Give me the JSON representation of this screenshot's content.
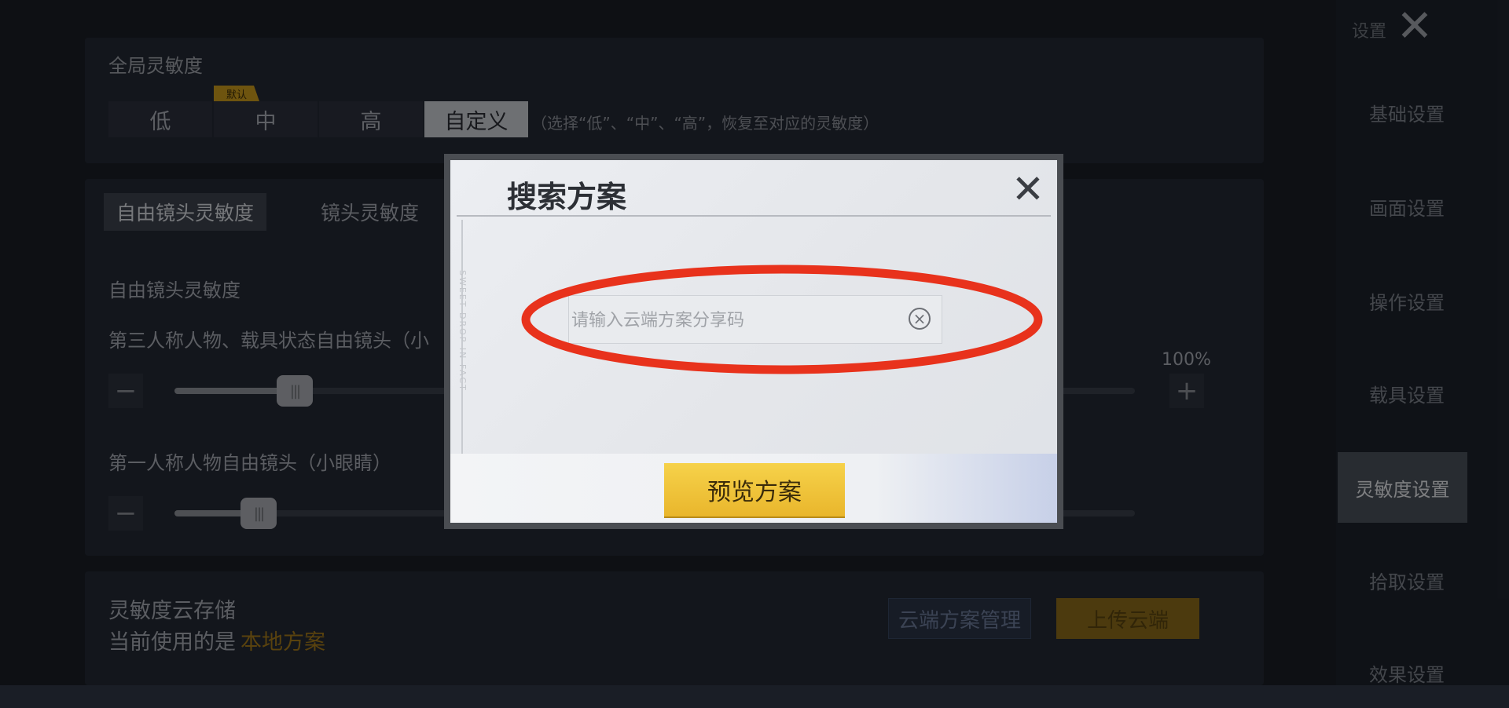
{
  "header": {
    "settings_label": "设置",
    "close_label": "✕"
  },
  "global": {
    "title": "全局灵敏度",
    "default_tag": "默认",
    "presets": [
      "低",
      "中",
      "高",
      "自定义"
    ],
    "hint": "（选择“低”、“中”、“高”，恢复至对应的灵敏度）"
  },
  "tabs": [
    "自由镜头灵敏度",
    "镜头灵敏度"
  ],
  "section": {
    "title": "自由镜头灵敏度",
    "row1_label": "第三人称人物、载具状态自由镜头（小",
    "row1_value": 0.21,
    "row1_percent": "100%",
    "row2_label": "第一人称人物自由镜头（小眼睛）",
    "row2_value": 0.15,
    "minus": "−",
    "plus": "+"
  },
  "cloud": {
    "title": "灵敏度云存储",
    "current_prefix": "当前使用的是",
    "current_value": "本地方案",
    "manage_button": "云端方案管理",
    "upload_button": "上传云端"
  },
  "sidebar": {
    "items": [
      "基础设置",
      "画面设置",
      "操作设置",
      "载具设置",
      "灵敏度设置",
      "拾取设置",
      "效果设置"
    ],
    "active_index": 4
  },
  "dialog": {
    "title": "搜索方案",
    "close_label": "✕",
    "search_placeholder": "请输入云端方案分享码",
    "clear_label": "×",
    "preview_button": "预览方案",
    "deco_text": "SWEET DROP IN FACT"
  },
  "colors": {
    "highlight_ellipse": "#e8321c",
    "accent_gold": "#e9b62c",
    "active_sidebar": "#4a5059"
  }
}
